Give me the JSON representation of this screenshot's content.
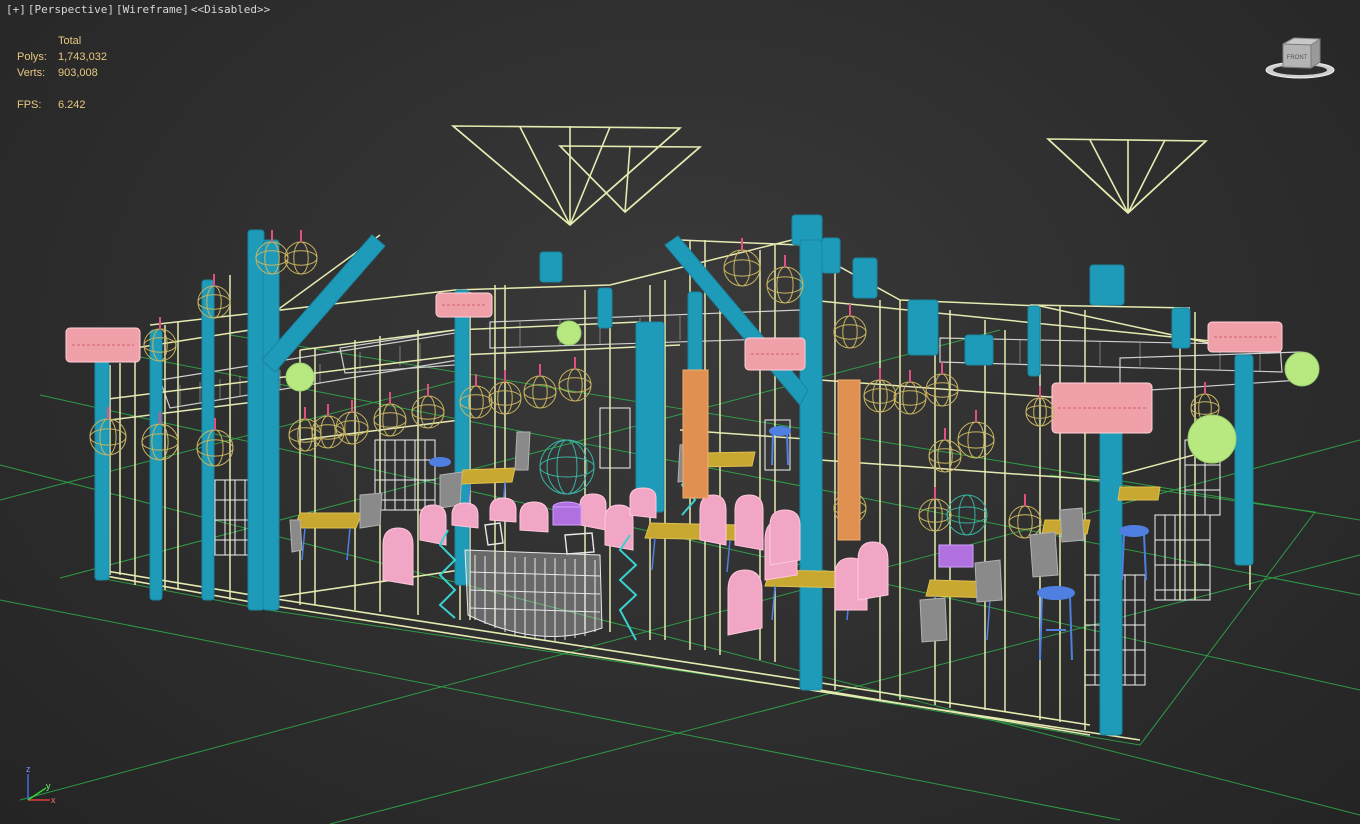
{
  "viewport": {
    "labels": [
      "[+]",
      "[Perspective]",
      "[Wireframe]",
      "<<Disabled>>"
    ]
  },
  "stats": {
    "header": "Total",
    "polys_label": "Polys:",
    "polys_value": "1,743,032",
    "verts_label": "Verts:",
    "verts_value": "903,008",
    "fps_label": "FPS:",
    "fps_value": "6.242"
  },
  "viewcube": {
    "face_label": "FRONT",
    "icon": "viewcube-icon"
  },
  "axis_tripod": {
    "x_label": "x",
    "y_label": "y",
    "z_label": "z"
  },
  "colors": {
    "background": "#303030",
    "grid": "#2fbf4f",
    "frame": "#e6eab0",
    "column": "#1e9bb8",
    "sign": "#f0a0a8",
    "seat": "#f2a6c6",
    "table_top": "#c8a830",
    "chair": "#8a8a8a",
    "stool": "#4f7fe0",
    "lantern": "#c8b460",
    "light_globe": "#b8e880",
    "duct": "#d0d0d0",
    "counter": "#e0e0e0",
    "panel": "#ffffff",
    "stats_text": "#e8c880",
    "label_text": "#d8d8d8"
  }
}
